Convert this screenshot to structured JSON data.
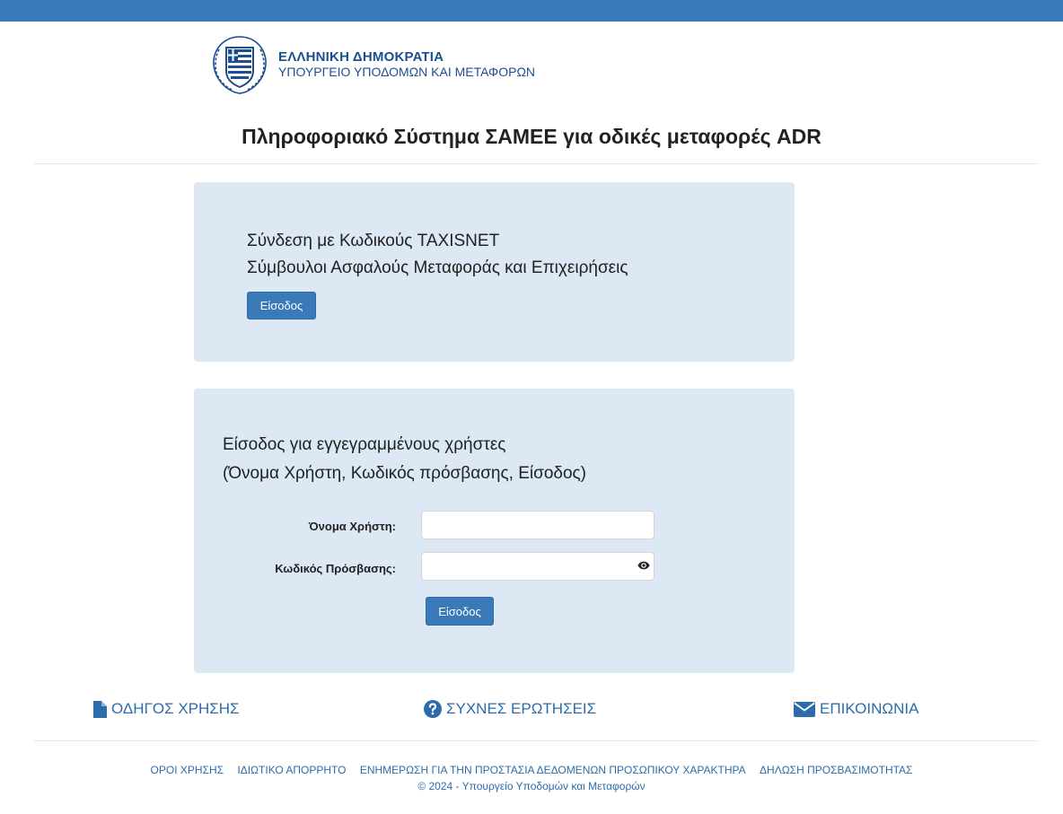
{
  "header": {
    "gov_title": "ΕΛΛΗΝΙΚΗ ΔΗΜΟΚΡΑΤΙΑ",
    "gov_subtitle": "ΥΠΟΥΡΓΕΙΟ ΥΠΟΔΟΜΩΝ ΚΑΙ ΜΕΤΑΦΟΡΩΝ",
    "emblem_icon": "greek-coat-of-arms-icon"
  },
  "page_title": "Πληροφοριακό Σύστημα ΣΑΜΕΕ για οδικές μεταφορές ADR",
  "taxisnet_panel": {
    "line1": "Σύνδεση με Κωδικούς TAXISNET",
    "line2": "Σύμβουλοι Ασφαλούς Μεταφοράς και Επιχειρήσεις",
    "button_label": "Είσοδος"
  },
  "login_panel": {
    "line1": "Είσοδος για εγγεγραμμένους χρήστες",
    "line2": "(Όνομα Χρήστη, Κωδικός πρόσβασης, Είσοδος)",
    "username_label": "Όνομα Χρήστη:",
    "username_value": "",
    "password_label": "Κωδικός Πρόσβασης:",
    "password_value": "",
    "password_toggle_icon": "eye-icon",
    "button_label": "Είσοδος"
  },
  "quick_links": [
    {
      "label": "ΟΔΗΓΟΣ ΧΡΗΣΗΣ",
      "icon": "document-icon"
    },
    {
      "label": "ΣΥΧΝΕΣ ΕΡΩΤΗΣΕΙΣ",
      "icon": "question-circle-icon"
    },
    {
      "label": "ΕΠΙΚΟΙΝΩΝΙΑ",
      "icon": "envelope-icon"
    }
  ],
  "footer": {
    "links": [
      "ΟΡΟΙ ΧΡΗΣΗΣ",
      "ΙΔΙΩΤΙΚΟ ΑΠΟΡΡΗΤΟ",
      "ΕΝΗΜΕΡΩΣΗ ΓΙΑ ΤΗΝ ΠΡΟΣΤΑΣΙΑ ΔΕΔΟΜΕΝΩΝ ΠΡΟΣΩΠΙΚΟΥ ΧΑΡΑΚΤΗΡΑ",
      "ΔΗΛΩΣΗ ΠΡΟΣΒΑΣΙΜΟΤΗΤΑΣ"
    ],
    "copyright": "© 2024 - Υπουργείο Υποδομών και Μεταφορών"
  },
  "colors": {
    "accent": "#3a7ab8",
    "panel_bg": "#dce8f4",
    "link": "#2d6cab",
    "gov_text": "#1d4f8f"
  }
}
